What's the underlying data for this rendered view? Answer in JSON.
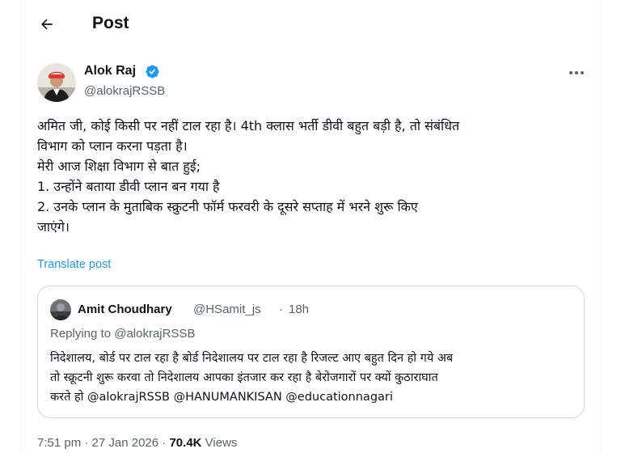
{
  "header": {
    "title": "Post",
    "back_icon": "arrow-left-icon"
  },
  "author": {
    "name": "Alok Raj",
    "handle": "@alokrajRSSB",
    "verified": true,
    "verified_color": "#1d9bf0"
  },
  "post": {
    "lines": [
      "अमित जी, कोई किसी पर नहीं टाल रहा है। 4th क्लास भर्ती डीवी बहुत बड़ी है, तो संबंधित",
      "विभाग को प्लान करना पड़ता है।",
      "मेरी आज शिक्षा विभाग से बात हुई;",
      "1. उन्होंने बताया डीवी प्लान बन गया है",
      "2. उनके प्लान के मुताबिक स्क्रुटनी फॉर्म फरवरी के दूसरे सप्ताह में भरने शुरू किए",
      "जाएंगे।"
    ],
    "translate_label": "Translate post"
  },
  "quote": {
    "name": "Amit Choudhary",
    "handle": "@HSamit_js",
    "separator": "·",
    "time": "18h",
    "replying_prefix": "Replying to",
    "replying_handle": "@alokrajRSSB",
    "lines": [
      "निदेशालय, बोर्ड पर टाल रहा है बोर्ड निदेशालय पर टाल रहा है रिजल्ट आए बहुत दिन हो गये अब",
      "तो स्क्रूटनी शुरू करवा तो निदेशालय आपका इंतजार कर रहा है बेरोजगारों पर क्यों कुठाराघात",
      "करते हो @alokrajRSSB @HANUMANKISAN @educationnagari"
    ]
  },
  "meta": {
    "time": "7:51 pm",
    "separator": "·",
    "date": "27 Jan 2026",
    "views_count": "70.4K",
    "views_label": "Views"
  },
  "colors": {
    "accent": "#1d9bf0",
    "secondary_text": "#536471",
    "border": "#cfd9de"
  }
}
